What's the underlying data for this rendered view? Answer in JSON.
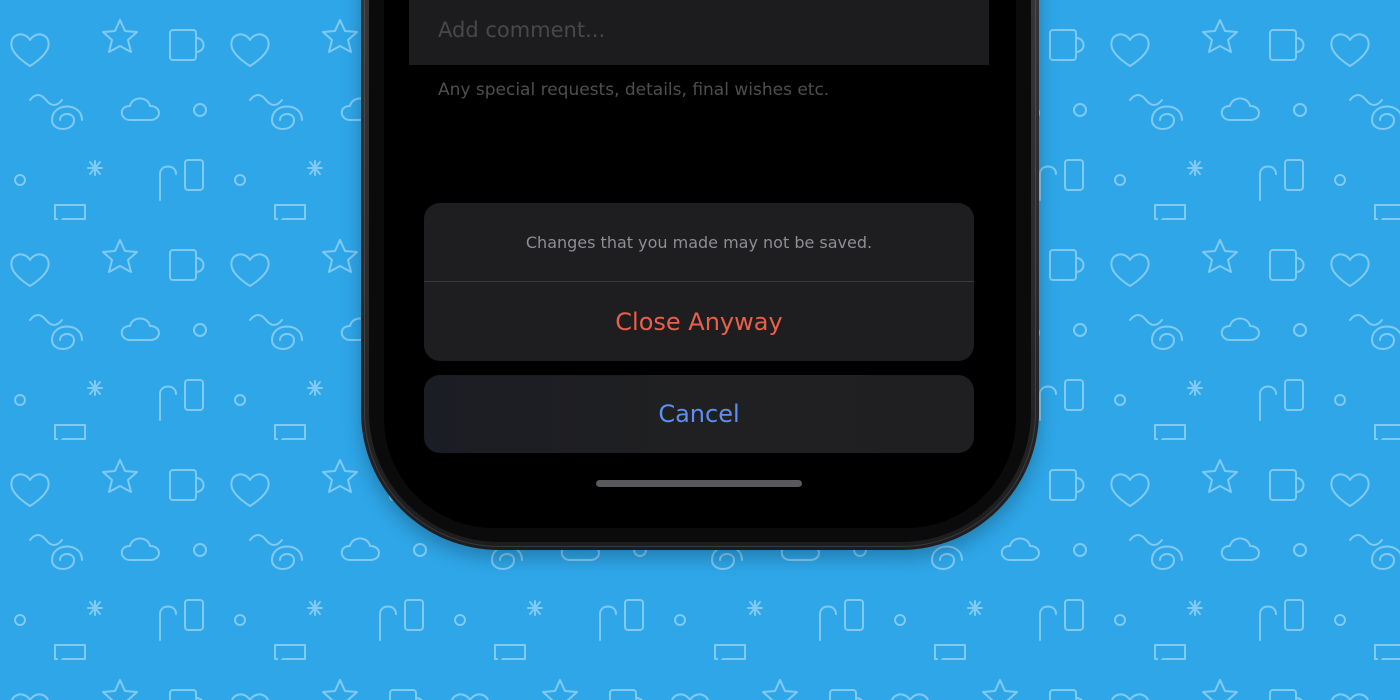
{
  "colors": {
    "background": "#2ea6e8",
    "pattern_stroke": "#8fd0f5",
    "destructive": "#e8604c",
    "cancel": "#5d8ff0",
    "sheet": "#1e1e20"
  },
  "screen": {
    "comment_placeholder": "Add comment...",
    "comment_hint": "Any special requests, details, final wishes etc."
  },
  "action_sheet": {
    "message": "Changes that you made may not be saved.",
    "destructive_label": "Close Anyway",
    "cancel_label": "Cancel"
  },
  "icons": {
    "pattern": "doodle-pattern",
    "home_indicator": "home-indicator-bar"
  }
}
